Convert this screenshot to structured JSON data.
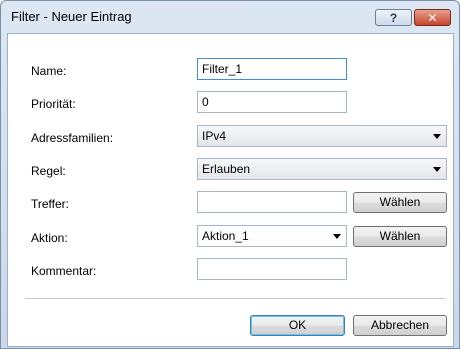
{
  "window": {
    "title": "Filter - Neuer Eintrag",
    "help_label": "?",
    "close_label": "✕"
  },
  "form": {
    "name": {
      "label": "Name:",
      "value": "Filter_1"
    },
    "priority": {
      "label": "Priorität:",
      "value": "0"
    },
    "address_families": {
      "label": "Adressfamilien:",
      "value": "IPv4"
    },
    "rule": {
      "label": "Regel:",
      "value": "Erlauben"
    },
    "hits": {
      "label": "Treffer:",
      "value": "",
      "button": "Wählen"
    },
    "action": {
      "label": "Aktion:",
      "value": "Aktion_1",
      "button": "Wählen"
    },
    "comment": {
      "label": "Kommentar:",
      "value": ""
    }
  },
  "buttons": {
    "ok": "OK",
    "cancel": "Abbrechen"
  },
  "colors": {
    "title_bar": "#c9d9ea",
    "close_button": "#c5442c",
    "focus_border": "#3d8ee0"
  }
}
